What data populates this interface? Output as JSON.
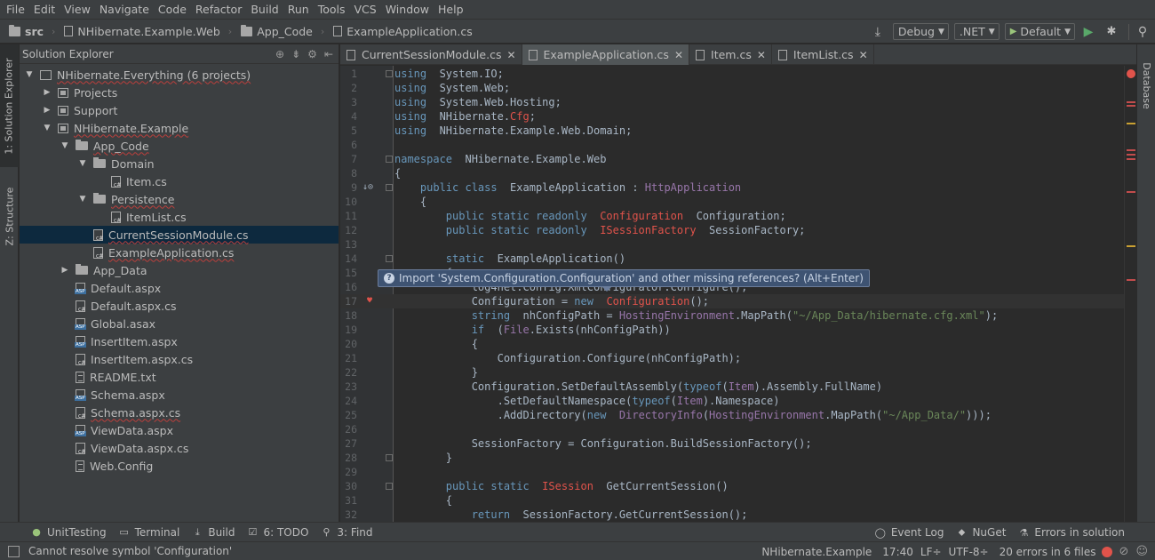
{
  "menu": [
    "File",
    "Edit",
    "View",
    "Navigate",
    "Code",
    "Refactor",
    "Build",
    "Run",
    "Tools",
    "VCS",
    "Window",
    "Help"
  ],
  "breadcrumbs": [
    "src",
    "NHibernate.Example.Web",
    "App_Code",
    "ExampleApplication.cs"
  ],
  "toolbar": {
    "config": "Debug",
    "framework": ".NET",
    "run_config": "Default"
  },
  "left_tool_tabs": [
    "1: Solution Explorer",
    "Z: Structure"
  ],
  "right_tool_tabs": [
    "Database"
  ],
  "explorer": {
    "title": "Solution Explorer",
    "items": [
      {
        "label": "NHibernate.Everything (6 projects)",
        "icon": "solution-icon",
        "arrow": "▼",
        "depth": 0,
        "squiggle": true
      },
      {
        "label": "Projects",
        "icon": "project-icon",
        "arrow": "▶",
        "depth": 1
      },
      {
        "label": "Support",
        "icon": "project-icon",
        "arrow": "▶",
        "depth": 1
      },
      {
        "label": "NHibernate.Example",
        "icon": "project-icon",
        "arrow": "▼",
        "depth": 1,
        "squiggle": true
      },
      {
        "label": "App_Code",
        "icon": "folder-icon",
        "arrow": "▼",
        "depth": 2,
        "squiggle": true
      },
      {
        "label": "Domain",
        "icon": "folder-icon",
        "arrow": "▼",
        "depth": 3
      },
      {
        "label": "Item.cs",
        "icon": "csharp-file-icon",
        "arrow": "",
        "depth": 4
      },
      {
        "label": "Persistence",
        "icon": "folder-icon",
        "arrow": "▼",
        "depth": 3,
        "squiggle": true
      },
      {
        "label": "ItemList.cs",
        "icon": "csharp-file-icon",
        "arrow": "",
        "depth": 4
      },
      {
        "label": "CurrentSessionModule.cs",
        "icon": "csharp-file-icon",
        "arrow": "",
        "depth": 3,
        "squiggle": true,
        "selected": true
      },
      {
        "label": "ExampleApplication.cs",
        "icon": "csharp-file-icon",
        "arrow": "",
        "depth": 3,
        "squiggle": true
      },
      {
        "label": "App_Data",
        "icon": "folder-icon",
        "arrow": "▶",
        "depth": 2
      },
      {
        "label": "Default.aspx",
        "icon": "aspx-file-icon",
        "arrow": "",
        "depth": 2
      },
      {
        "label": "Default.aspx.cs",
        "icon": "csharp-file-icon",
        "arrow": "",
        "depth": 2
      },
      {
        "label": "Global.asax",
        "icon": "aspx-file-icon",
        "arrow": "",
        "depth": 2
      },
      {
        "label": "InsertItem.aspx",
        "icon": "aspx-file-icon",
        "arrow": "",
        "depth": 2
      },
      {
        "label": "InsertItem.aspx.cs",
        "icon": "csharp-file-icon",
        "arrow": "",
        "depth": 2
      },
      {
        "label": "README.txt",
        "icon": "text-file-icon",
        "arrow": "",
        "depth": 2
      },
      {
        "label": "Schema.aspx",
        "icon": "aspx-file-icon",
        "arrow": "",
        "depth": 2
      },
      {
        "label": "Schema.aspx.cs",
        "icon": "csharp-file-icon",
        "arrow": "",
        "depth": 2,
        "squiggle": true
      },
      {
        "label": "ViewData.aspx",
        "icon": "aspx-file-icon",
        "arrow": "",
        "depth": 2
      },
      {
        "label": "ViewData.aspx.cs",
        "icon": "csharp-file-icon",
        "arrow": "",
        "depth": 2
      },
      {
        "label": "Web.Config",
        "icon": "text-file-icon",
        "arrow": "",
        "depth": 2
      }
    ]
  },
  "tabs": [
    {
      "label": "CurrentSessionModule.cs",
      "active": false
    },
    {
      "label": "ExampleApplication.cs",
      "active": true
    },
    {
      "label": "Item.cs",
      "active": false
    },
    {
      "label": "ItemList.cs",
      "active": false
    }
  ],
  "editor": {
    "lines": [
      {
        "n": "1",
        "code": [
          [
            "kwb",
            "using"
          ],
          [
            "",
            "  System.IO;"
          ]
        ]
      },
      {
        "n": "2",
        "code": [
          [
            "kwb",
            "using"
          ],
          [
            "",
            "  System.Web;"
          ]
        ]
      },
      {
        "n": "3",
        "code": [
          [
            "kwb",
            "using"
          ],
          [
            "",
            "  System.Web.Hosting;"
          ]
        ]
      },
      {
        "n": "4",
        "code": [
          [
            "kwb",
            "using"
          ],
          [
            "",
            "  NHibernate."
          ],
          [
            "err",
            "Cfg"
          ],
          [
            "",
            ";"
          ]
        ]
      },
      {
        "n": "5",
        "code": [
          [
            "kwb",
            "using"
          ],
          [
            "",
            "  NHibernate.Example.Web.Domain;"
          ]
        ]
      },
      {
        "n": "6",
        "code": []
      },
      {
        "n": "7",
        "code": [
          [
            "kwb",
            "namespace"
          ],
          [
            "",
            "  NHibernate.Example.Web"
          ]
        ]
      },
      {
        "n": "8",
        "code": [
          [
            "",
            "{"
          ]
        ]
      },
      {
        "n": "9",
        "code": [
          [
            "",
            "    "
          ],
          [
            "kwb",
            "public class"
          ],
          [
            "",
            "  ExampleApplication : "
          ],
          [
            "link",
            "HttpApplication"
          ]
        ]
      },
      {
        "n": "10",
        "code": [
          [
            "",
            "    {"
          ]
        ]
      },
      {
        "n": "11",
        "code": [
          [
            "",
            "        "
          ],
          [
            "kwb",
            "public static readonly"
          ],
          [
            "",
            "  "
          ],
          [
            "err",
            "Configuration"
          ],
          [
            "",
            "  Configuration;"
          ]
        ]
      },
      {
        "n": "12",
        "code": [
          [
            "",
            "        "
          ],
          [
            "kwb",
            "public static readonly"
          ],
          [
            "",
            "  "
          ],
          [
            "err",
            "ISessionFactory"
          ],
          [
            "",
            "  SessionFactory;"
          ]
        ]
      },
      {
        "n": "13",
        "code": []
      },
      {
        "n": "14",
        "code": [
          [
            "",
            "        "
          ],
          [
            "kwb",
            "static"
          ],
          [
            "",
            "  ExampleApplication()"
          ]
        ]
      },
      {
        "n": "15",
        "code": [
          [
            "",
            "        {"
          ]
        ]
      },
      {
        "n": "16",
        "code": [
          [
            "",
            "            log4net.Config.XmlConfigurator.Configure();"
          ]
        ]
      },
      {
        "n": "17",
        "code": [
          [
            "",
            "            Configuration = "
          ],
          [
            "kwb",
            "new"
          ],
          [
            "",
            "  "
          ],
          [
            "err",
            "Configuration"
          ],
          [
            "",
            "();"
          ]
        ]
      },
      {
        "n": "18",
        "code": [
          [
            "",
            "            "
          ],
          [
            "kwb",
            "string"
          ],
          [
            "",
            "  nhConfigPath = "
          ],
          [
            "link",
            "HostingEnvironment"
          ],
          [
            "",
            ".MapPath("
          ],
          [
            "str",
            "\"~/App_Data/hibernate.cfg.xml\""
          ],
          [
            "",
            ");"
          ]
        ]
      },
      {
        "n": "19",
        "code": [
          [
            "",
            "            "
          ],
          [
            "kwb",
            "if"
          ],
          [
            "",
            "  ("
          ],
          [
            "link",
            "File"
          ],
          [
            "",
            ".Exists(nhConfigPath))"
          ]
        ]
      },
      {
        "n": "20",
        "code": [
          [
            "",
            "            {"
          ]
        ]
      },
      {
        "n": "21",
        "code": [
          [
            "",
            "                Configuration.Configure(nhConfigPath);"
          ]
        ]
      },
      {
        "n": "22",
        "code": [
          [
            "",
            "            }"
          ]
        ]
      },
      {
        "n": "23",
        "code": [
          [
            "",
            "            Configuration.SetDefaultAssembly("
          ],
          [
            "kwb",
            "typeof"
          ],
          [
            "",
            "("
          ],
          [
            "link",
            "Item"
          ],
          [
            "",
            ").Assembly.FullName)"
          ]
        ]
      },
      {
        "n": "24",
        "code": [
          [
            "",
            "                .SetDefaultNamespace("
          ],
          [
            "kwb",
            "typeof"
          ],
          [
            "",
            "("
          ],
          [
            "link",
            "Item"
          ],
          [
            "",
            ").Namespace)"
          ]
        ]
      },
      {
        "n": "25",
        "code": [
          [
            "",
            "                .AddDirectory("
          ],
          [
            "kwb",
            "new"
          ],
          [
            "",
            "  "
          ],
          [
            "link",
            "DirectoryInfo"
          ],
          [
            "",
            "("
          ],
          [
            "link",
            "HostingEnvironment"
          ],
          [
            "",
            ".MapPath("
          ],
          [
            "str",
            "\"~/App_Data/\""
          ],
          [
            "",
            ")));"
          ]
        ]
      },
      {
        "n": "26",
        "code": []
      },
      {
        "n": "27",
        "code": [
          [
            "",
            "            SessionFactory = Configuration.BuildSessionFactory();"
          ]
        ]
      },
      {
        "n": "28",
        "code": [
          [
            "",
            "        }"
          ]
        ]
      },
      {
        "n": "29",
        "code": []
      },
      {
        "n": "30",
        "code": [
          [
            "",
            "        "
          ],
          [
            "kwb",
            "public static"
          ],
          [
            "",
            "  "
          ],
          [
            "err",
            "ISession"
          ],
          [
            "",
            "  GetCurrentSession()"
          ]
        ]
      },
      {
        "n": "31",
        "code": [
          [
            "",
            "        {"
          ]
        ]
      },
      {
        "n": "32",
        "code": [
          [
            "",
            "            "
          ],
          [
            "kwb",
            "return"
          ],
          [
            "",
            "  SessionFactory.GetCurrentSession();"
          ]
        ]
      }
    ],
    "tooltip": "Import 'System.Configuration.Configuration' and other missing references? (Alt+Enter)"
  },
  "bottom_tabs": [
    {
      "label": "UnitTesting",
      "icon": "unittest-icon"
    },
    {
      "label": "Terminal",
      "icon": "terminal-icon"
    },
    {
      "label": "Build",
      "icon": "build-icon"
    },
    {
      "label": "6: TODO",
      "icon": "todo-icon"
    },
    {
      "label": "3: Find",
      "icon": "find-icon"
    }
  ],
  "bottom_right": [
    {
      "label": "Event Log",
      "icon": "event-log-icon"
    },
    {
      "label": "NuGet",
      "icon": "nuget-icon"
    },
    {
      "label": "Errors in solution",
      "icon": "errors-icon"
    }
  ],
  "status": {
    "message": "Cannot resolve symbol 'Configuration'",
    "project": "NHibernate.Example",
    "position": "17:40",
    "line_sep": "LF÷",
    "encoding": "UTF-8÷",
    "errors": "20 errors in 6 files"
  },
  "colors": {
    "keyword": "#6897bb",
    "error": "#e0534b",
    "string": "#6a8759",
    "type": "#9876aa",
    "selection": "#0d293e"
  }
}
